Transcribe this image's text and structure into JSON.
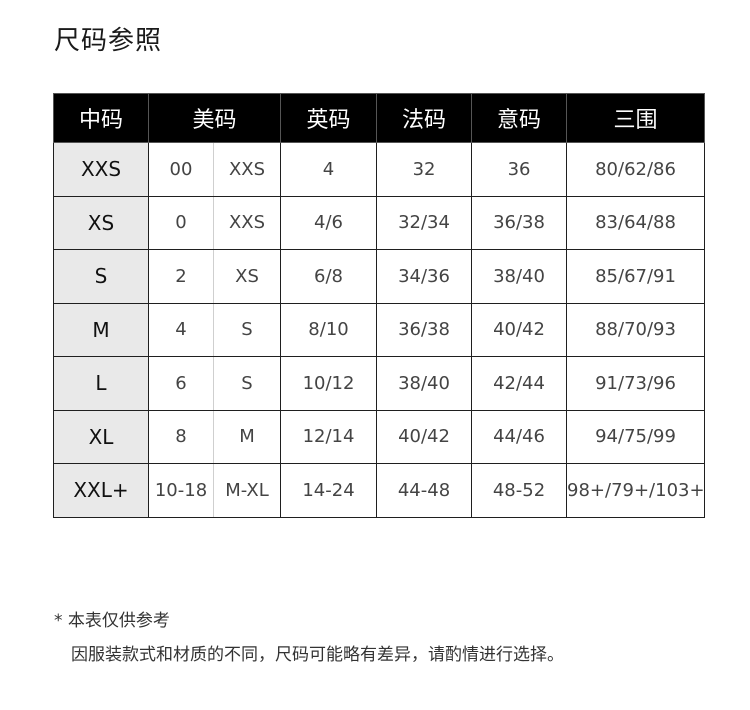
{
  "title": "尺码参照",
  "table": {
    "headers": [
      "中码",
      "美码",
      "英码",
      "法码",
      "意码",
      "三围"
    ],
    "rows": [
      [
        "XXS",
        "00",
        "XXS",
        "4",
        "32",
        "36",
        "80/62/86"
      ],
      [
        "XS",
        "0",
        "XXS",
        "4/6",
        "32/34",
        "36/38",
        "83/64/88"
      ],
      [
        "S",
        "2",
        "XS",
        "6/8",
        "34/36",
        "38/40",
        "85/67/91"
      ],
      [
        "M",
        "4",
        "S",
        "8/10",
        "36/38",
        "40/42",
        "88/70/93"
      ],
      [
        "L",
        "6",
        "S",
        "10/12",
        "38/40",
        "42/44",
        "91/73/96"
      ],
      [
        "XL",
        "8",
        "M",
        "12/14",
        "40/42",
        "44/46",
        "94/75/99"
      ],
      [
        "XXL+",
        "10-18",
        "M-XL",
        "14-24",
        "44-48",
        "48-52",
        "98+/79+/103+"
      ]
    ]
  },
  "note": {
    "title": "* 本表仅供参考",
    "detail": "因服装款式和材质的不同，尺码可能略有差异，请酌情进行选择。"
  },
  "colors": {
    "header_bg": "#000000",
    "header_text": "#ffffff",
    "rowhead_bg": "#e9e9e9",
    "border": "#1f1f1f"
  }
}
